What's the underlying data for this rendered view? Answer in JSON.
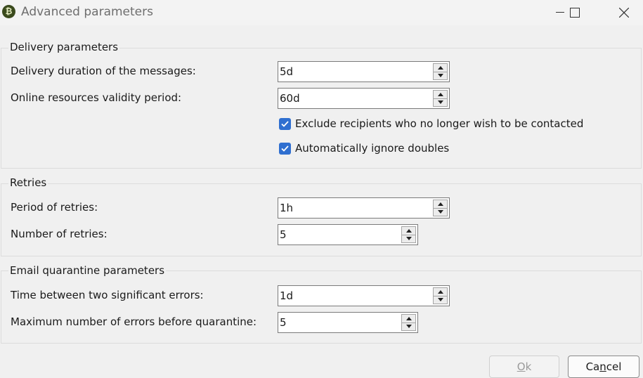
{
  "window": {
    "title": "Advanced parameters",
    "app_icon_glyph": "₿",
    "controls": [
      "minimize-icon",
      "maximize-icon",
      "close-icon"
    ]
  },
  "delivery": {
    "title": "Delivery parameters",
    "duration_label": "Delivery duration of the messages:",
    "duration_value": "5d",
    "validity_label": "Online resources validity period:",
    "validity_value": "60d",
    "exclude_label": "Exclude recipients who no longer wish to be contacted",
    "exclude_checked": true,
    "ignore_doubles_label": "Automatically ignore doubles",
    "ignore_doubles_checked": true
  },
  "retries": {
    "title": "Retries",
    "period_label": "Period of retries:",
    "period_value": "1h",
    "number_label": "Number of retries:",
    "number_value": "5"
  },
  "quarantine": {
    "title": "Email quarantine parameters",
    "time_label": "Time between two significant errors:",
    "time_value": "1d",
    "max_errors_label": "Maximum number of errors before quarantine:",
    "max_errors_value": "5"
  },
  "buttons": {
    "ok_accel": "O",
    "ok_rest": "k",
    "ok_enabled": false,
    "cancel_prefix": "Ca",
    "cancel_accel": "n",
    "cancel_rest": "cel"
  },
  "colors": {
    "accent": "#2f6fd0",
    "disabled_text": "#9a9a9a",
    "background": "#f0f0f0"
  }
}
